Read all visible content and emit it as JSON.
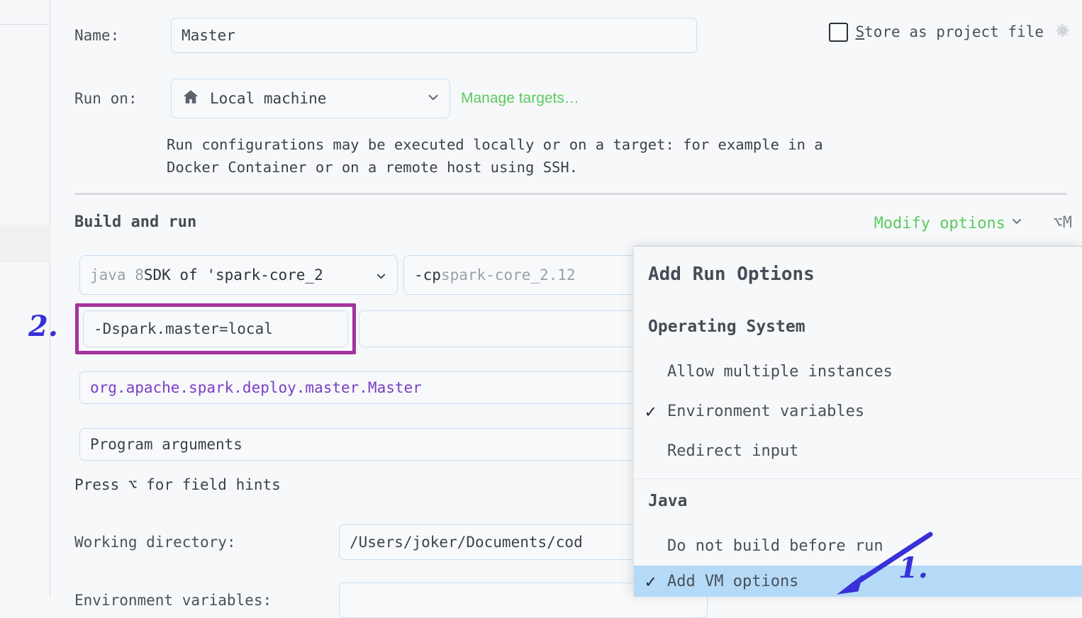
{
  "form": {
    "name_label": "Name:",
    "name_value": "Master",
    "store_label_mnemonic": "S",
    "store_label_rest": "tore as project file",
    "store_checked": false,
    "gear_icon": "gear-icon",
    "run_on_label": "Run on:",
    "run_on_value": "Local machine",
    "run_on_icon": "home-icon",
    "run_on_chevron": "chevron-down-icon",
    "manage_targets_link": "Manage targets…",
    "run_on_description": "Run configurations may be executed locally or on a target: for example in a Docker Container or on a remote host using SSH.",
    "field_hints": "Press ⌥ for field hints"
  },
  "build_section": {
    "header": "Build and run",
    "modify_options_label": "Modify options",
    "modify_options_chevron": "chevron-down-icon",
    "modify_options_shortcut": "⌥M",
    "jdk_field": {
      "dim_prefix": "java 8 ",
      "strong_text": "SDK of 'spark-core_2",
      "chevron": "chevron-down-icon"
    },
    "classpath_field": {
      "strong_text": "-cp ",
      "dim_text": "spark-core_2.12"
    },
    "vm_options_value": "-Dspark.master=local",
    "main_class_value": "org.apache.spark.deploy.master.Master",
    "program_arguments_placeholder": "Program arguments",
    "working_directory_label": "Working directory:",
    "working_directory_value": "/Users/joker/Documents/cod",
    "environment_variables_label": "Environment variables:",
    "environment_variables_value": ""
  },
  "popup": {
    "title": "Add Run Options",
    "groups": [
      {
        "label": "Operating System",
        "items": [
          {
            "label": "Allow multiple instances",
            "checked": false,
            "highlighted": false
          },
          {
            "label": "Environment variables",
            "checked": true,
            "highlighted": false
          },
          {
            "label": "Redirect input",
            "checked": false,
            "highlighted": false
          }
        ]
      },
      {
        "label": "Java",
        "items": [
          {
            "label": "Do not build before run",
            "checked": false,
            "highlighted": false
          },
          {
            "label": "Add VM options",
            "checked": true,
            "highlighted": true
          }
        ]
      }
    ],
    "checkmark_glyph": "✓"
  },
  "annotations": {
    "step_one": "1.",
    "step_two": "2.",
    "arrow_color": "#3830d8",
    "highlight_box_color": "#a5339d",
    "highlight_row_color": "#b4daf7"
  }
}
